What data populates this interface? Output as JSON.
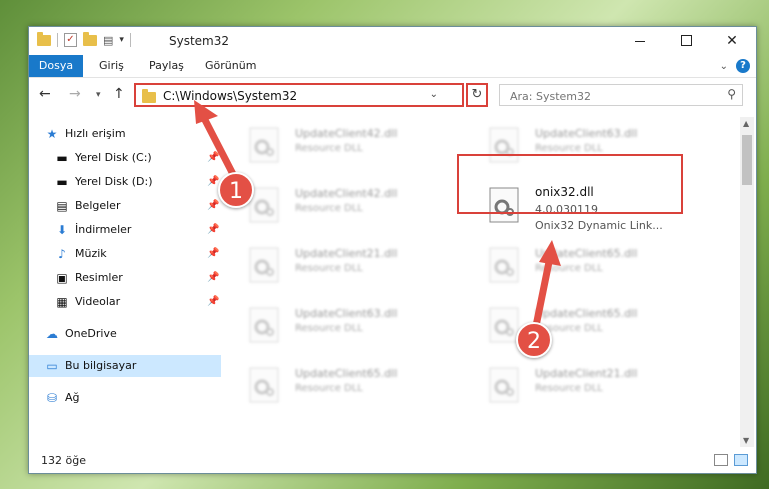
{
  "window": {
    "title": "System32"
  },
  "ribbon": {
    "tabs": [
      "Dosya",
      "Giriş",
      "Paylaş",
      "Görünüm"
    ]
  },
  "address": {
    "path": "C:\\Windows\\System32"
  },
  "search": {
    "placeholder": "Ara: System32"
  },
  "nav": {
    "quick_access": "Hızlı erişim",
    "items": [
      "Yerel Disk (C:)",
      "Yerel Disk (D:)",
      "Belgeler",
      "İndirmeler",
      "Müzik",
      "Resimler",
      "Videolar"
    ],
    "onedrive": "OneDrive",
    "this_pc": "Bu bilgisayar",
    "network": "Ağ"
  },
  "files": [
    {
      "name": "UpdateClient42.dll",
      "sub": "Resource DLL"
    },
    {
      "name": "UpdateClient63.dll",
      "sub": "Resource DLL"
    },
    {
      "name": "UpdateClient42.dll",
      "sub": "Resource DLL"
    },
    {
      "name": "UpdateClient21.dll",
      "sub": "Resource DLL"
    },
    {
      "name": "UpdateClient65.dll",
      "sub": "Resource DLL"
    },
    {
      "name": "UpdateClient63.dll",
      "sub": "Resource DLL"
    },
    {
      "name": "UpdateClient65.dll",
      "sub": "Resource DLL"
    },
    {
      "name": "UpdateClient65.dll",
      "sub": "Resource DLL"
    },
    {
      "name": "UpdateClient21.dll",
      "sub": "Resource DLL"
    }
  ],
  "target_file": {
    "name": "onix32.dll",
    "version": "4,0,030119",
    "description": "Onix32 Dynamic Link..."
  },
  "status": {
    "count": "132 öğe"
  },
  "annotations": {
    "badge1": "1",
    "badge2": "2"
  },
  "colors": {
    "accent": "#1979ca",
    "highlight": "#d9413a",
    "selection": "#cce8ff"
  }
}
